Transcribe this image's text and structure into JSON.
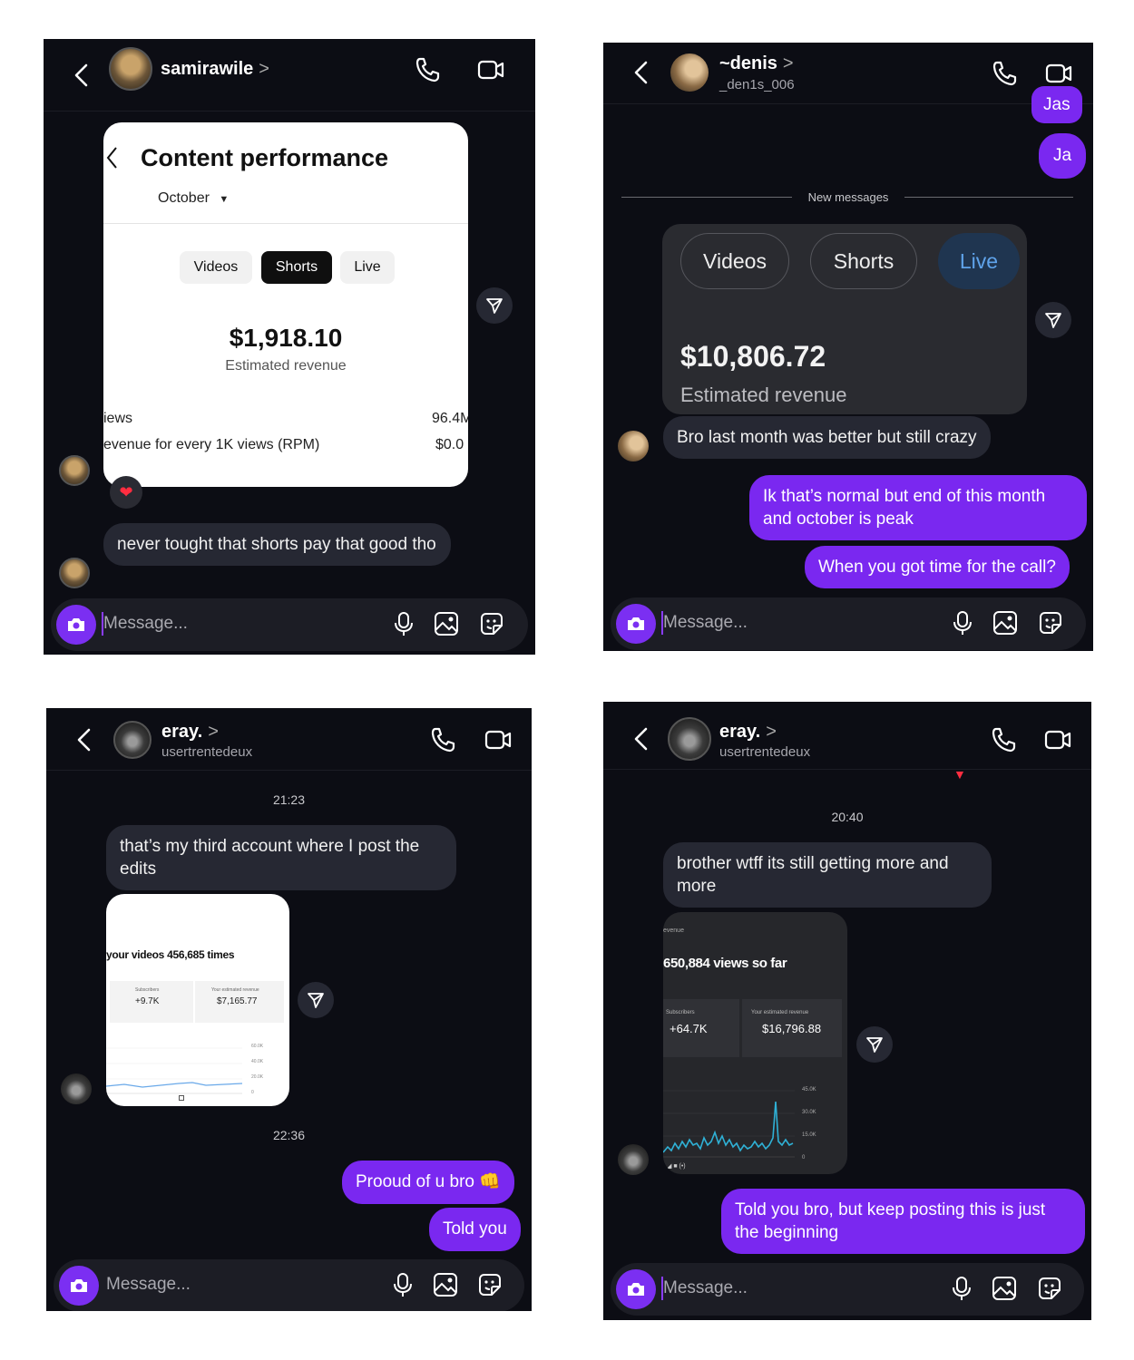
{
  "icons": [
    "back-icon",
    "phone-icon",
    "video-icon",
    "share-icon",
    "camera-icon",
    "mic-icon",
    "gallery-icon",
    "sticker-icon",
    "heart-icon",
    "dropdown-icon"
  ],
  "colors": {
    "bg": "#0c0d14",
    "bubble_in": "#262833",
    "bubble_out": "#7a28f0",
    "accent": "#7b2ff2",
    "live": "#1f3550"
  },
  "composer_placeholder": "Message...",
  "panel1": {
    "username": "samirawile",
    "card": {
      "title": "Content performance",
      "month": "October",
      "tabs": [
        "Videos",
        "Shorts",
        "Live"
      ],
      "selected_tab": "Shorts",
      "amount": "$1,918.10",
      "amount_label": "Estimated revenue",
      "rows": [
        {
          "label": "iews",
          "value": "96.4M"
        },
        {
          "label": "evenue for every 1K views (RPM)",
          "value": "$0.0"
        }
      ]
    },
    "message_in": "never tought that shorts pay that good tho"
  },
  "panel2": {
    "username": "~denis",
    "handle": "_den1s_006",
    "prev_out": [
      "Jas",
      "Ja"
    ],
    "new_messages": "New messages",
    "card": {
      "tabs": [
        "Videos",
        "Shorts",
        "Live"
      ],
      "selected_tab": "Live",
      "amount": "$10,806.72",
      "amount_label": "Estimated revenue"
    },
    "message_in": "Bro last  month was better but still crazy",
    "out1": "Ik that’s normal but end of this month and october is peak",
    "out2": "When you got time for the call?"
  },
  "panel3": {
    "username": "eray.",
    "handle": "usertrentedeux",
    "time1": "21:23",
    "message_in": "that’s my third account where I post the edits",
    "card": {
      "headline": "your videos 456,685 times",
      "stat1_label": "Subscribers",
      "stat1_value": "+9.7K",
      "stat2_label": "Your estimated revenue",
      "stat2_value": "$7,165.77",
      "y_ticks": [
        "60.0K",
        "40.0K",
        "20.0K",
        "0"
      ]
    },
    "time2": "22:36",
    "out1": "Prooud of u bro 👊",
    "out2": "Told you"
  },
  "panel4": {
    "username": "eray.",
    "handle": "usertrentedeux",
    "time1": "20:40",
    "message_in": "brother wtff its still getting more and more",
    "card": {
      "top_label": "evenue",
      "headline": "650,884 views so far",
      "stat1_label": "Subscribers",
      "stat1_value": "+64.7K",
      "stat2_label": "Your estimated revenue",
      "stat2_value": "$16,796.88",
      "y_ticks": [
        "45.0K",
        "30.0K",
        "15.0K",
        "0"
      ]
    },
    "out1": "Told you bro, but keep posting this is just the beginning"
  }
}
